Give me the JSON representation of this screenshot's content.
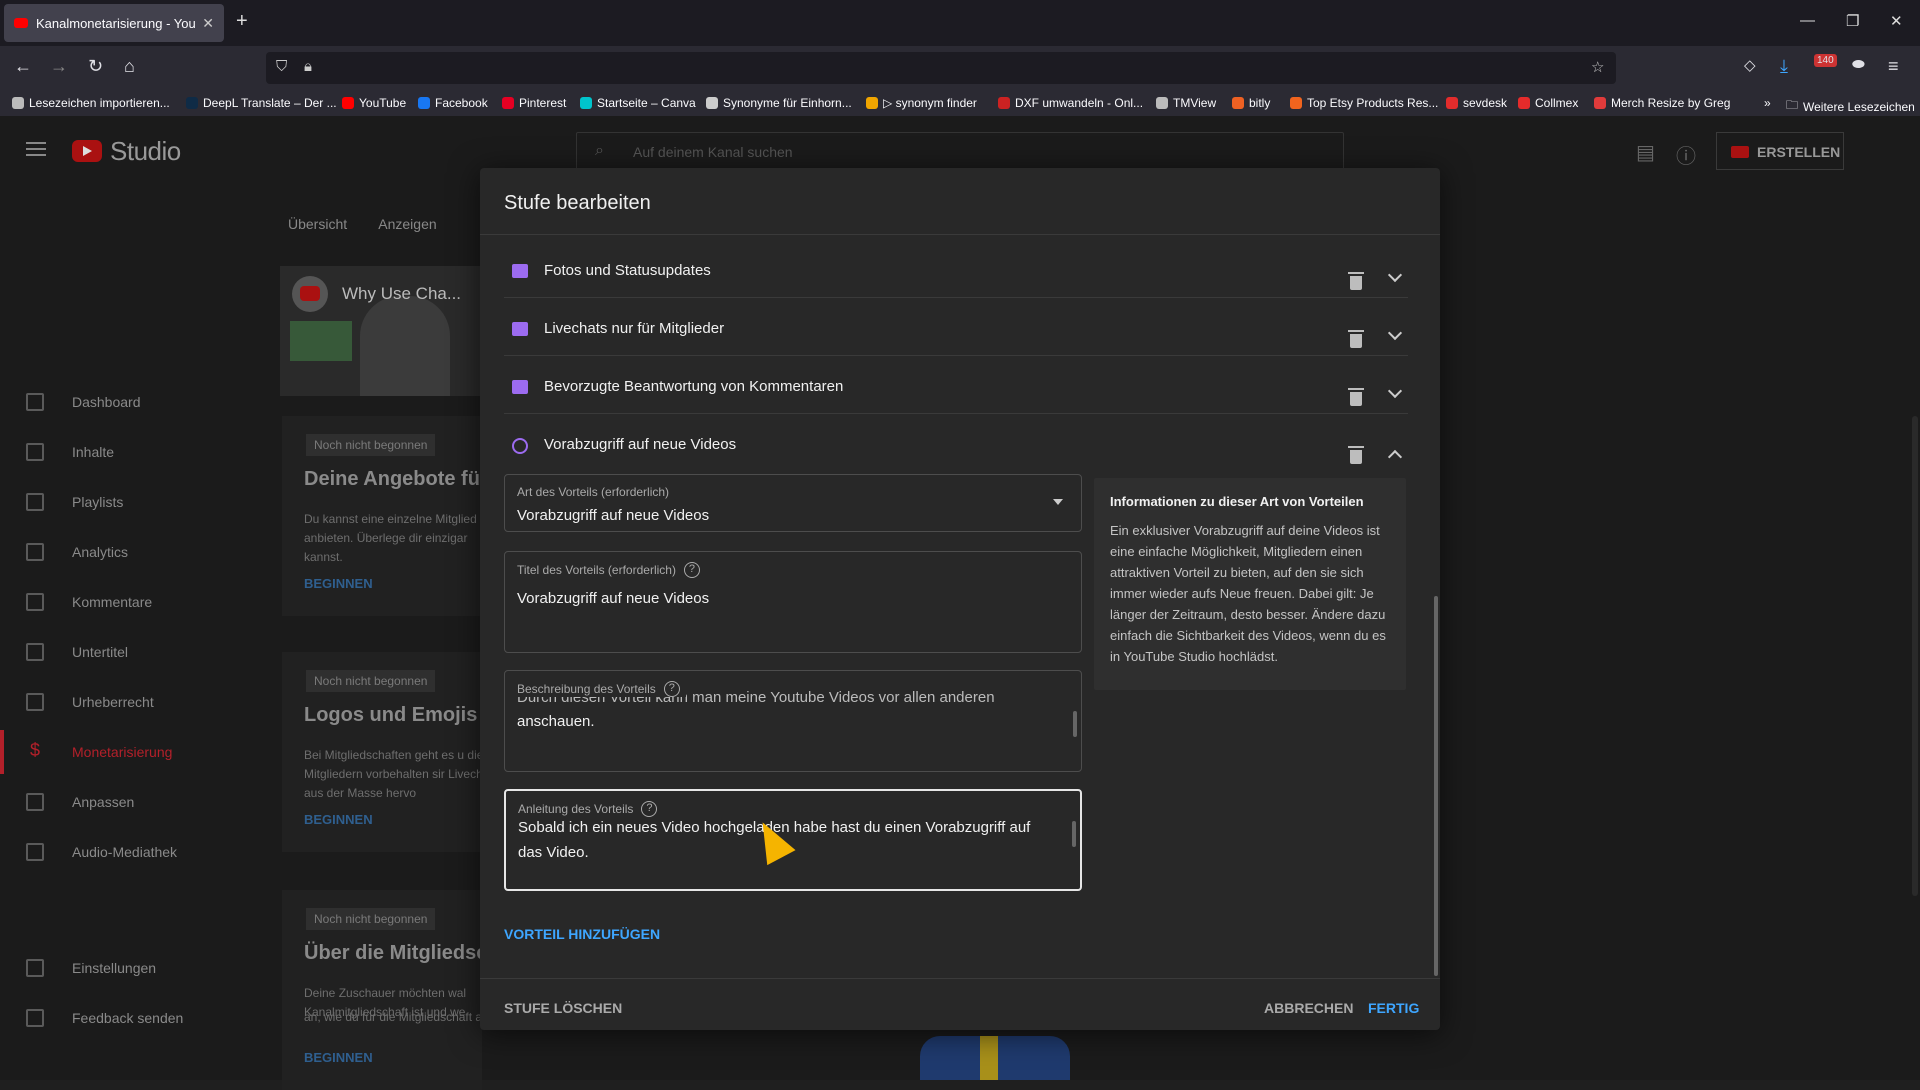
{
  "browser": {
    "tab_title": "Kanalmonetarisierung - YouTube",
    "new_tab": "+",
    "bookmarks": [
      {
        "label": "Lesezeichen importieren...",
        "color": "#bbbbbb"
      },
      {
        "label": "DeepL Translate – Der ...",
        "color": "#0f2b46"
      },
      {
        "label": "YouTube",
        "color": "#ff0000"
      },
      {
        "label": "Facebook",
        "color": "#1877f2"
      },
      {
        "label": "Pinterest",
        "color": "#e60023"
      },
      {
        "label": "Startseite – Canva",
        "color": "#00c4cc"
      },
      {
        "label": "Synonyme für Einhorn...",
        "color": "#cccccc"
      },
      {
        "label": "▷ synonym finder",
        "color": "#f0a500"
      },
      {
        "label": "DXF umwandeln - Onl...",
        "color": "#cc2222"
      },
      {
        "label": "TMView",
        "color": "#bbbbbb"
      },
      {
        "label": "bitly",
        "color": "#ee6123"
      },
      {
        "label": "Top Etsy Products Res...",
        "color": "#f1641e"
      },
      {
        "label": "sevdesk",
        "color": "#e22c2c"
      },
      {
        "label": "Collmex",
        "color": "#e52b2b"
      },
      {
        "label": "Merch Resize by Greg",
        "color": "#e03b3b"
      }
    ],
    "more_bookmarks": "»",
    "other_bookmarks": "Weitere Lesezeichen",
    "badge_count": "140"
  },
  "studio": {
    "logo_text": "Studio",
    "search_placeholder": "Auf deinem Kanal suchen",
    "create_label": "ERSTELLEN",
    "tabs": [
      "Übersicht",
      "Anzeigen"
    ],
    "video_title": "Why Use Cha...",
    "sidebar": [
      {
        "label": "Dashboard",
        "icon": "dashboard-icon"
      },
      {
        "label": "Inhalte",
        "icon": "content-icon"
      },
      {
        "label": "Playlists",
        "icon": "playlist-icon"
      },
      {
        "label": "Analytics",
        "icon": "analytics-icon"
      },
      {
        "label": "Kommentare",
        "icon": "comments-icon"
      },
      {
        "label": "Untertitel",
        "icon": "subtitles-icon"
      },
      {
        "label": "Urheberrecht",
        "icon": "copyright-icon"
      },
      {
        "label": "Monetarisierung",
        "icon": "dollar-icon",
        "active": true
      },
      {
        "label": "Anpassen",
        "icon": "customize-icon"
      },
      {
        "label": "Audio-Mediathek",
        "icon": "audio-library-icon"
      },
      {
        "label": "Einstellungen",
        "icon": "settings-icon"
      },
      {
        "label": "Feedback senden",
        "icon": "feedback-icon"
      }
    ],
    "cards": [
      {
        "badge": "Noch nicht begonnen",
        "title": "Deine Angebote für",
        "text": "Du kannst eine einzelne Mitglied anbieten. Überlege dir einzigar kannst.",
        "action": "BEGINNEN"
      },
      {
        "badge": "Noch nicht begonnen",
        "title": "Logos und Emojis h",
        "text": "Bei Mitgliedschaften geht es u die Mitgliedern vorbehalten sir Livechat aus der Masse hervo",
        "action": "BEGINNEN"
      },
      {
        "badge": "Noch nicht begonnen",
        "title": "Über die Mitgliedsc",
        "text": "Deine Zuschauer möchten wal Kanalmitgliedschaft ist und we",
        "action": "BEGINNEN"
      }
    ],
    "bottom_text": "an, wie du für die Mitgliedschaft auf deinem Kanal werben kannst."
  },
  "dialog": {
    "title": "Stufe bearbeiten",
    "perks": [
      {
        "label": "Fotos und Statusupdates",
        "icon": "image-icon",
        "expanded": false
      },
      {
        "label": "Livechats nur für Mitglieder",
        "icon": "chat-icon",
        "expanded": false
      },
      {
        "label": "Bevorzugte Beantwortung von Kommentaren",
        "icon": "comment-icon",
        "expanded": false
      },
      {
        "label": "Vorabzugriff auf neue Videos",
        "icon": "early-access-icon",
        "expanded": true
      }
    ],
    "perk_type": {
      "label": "Art des Vorteils (erforderlich)",
      "value": "Vorabzugriff auf neue Videos"
    },
    "perk_title": {
      "label": "Titel des Vorteils (erforderlich)",
      "value": "Vorabzugriff auf neue Videos"
    },
    "perk_description": {
      "label": "Beschreibung des Vorteils",
      "value_partial": "Durch diesen Vorteil kann man meine Youtube Videos vor allen anderen",
      "value": "anschauen."
    },
    "perk_instructions": {
      "label": "Anleitung des Vorteils",
      "value": "Sobald ich ein neues Video hochgeladen habe hast du einen Vorabzugriff auf das Video."
    },
    "info": {
      "title": "Informationen zu dieser Art von Vorteilen",
      "text": "Ein exklusiver Vorabzugriff auf deine Videos ist eine einfache Möglichkeit, Mitgliedern einen attraktiven Vorteil zu bieten, auf den sie sich immer wieder aufs Neue freuen. Dabei gilt: Je länger der Zeitraum, desto besser. Ändere dazu einfach die Sichtbarkeit des Videos, wenn du es in YouTube Studio hochlädst."
    },
    "add_perk": "VORTEIL HINZUFÜGEN",
    "delete_tier": "STUFE LÖSCHEN",
    "cancel": "ABBRECHEN",
    "done": "FERTIG",
    "help_glyph": "?"
  }
}
